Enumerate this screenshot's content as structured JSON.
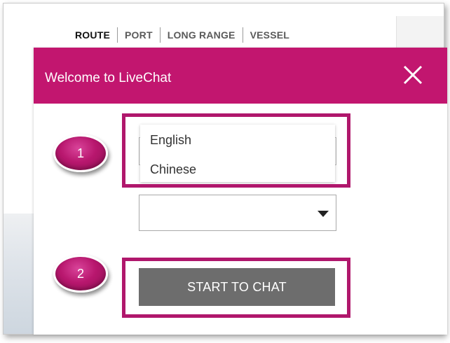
{
  "nav": {
    "items": [
      "ROUTE",
      "PORT",
      "LONG RANGE",
      "VESSEL"
    ],
    "active": "ROUTE"
  },
  "dialog": {
    "title": "Welcome to LiveChat",
    "close_icon": "close-icon",
    "language_options": [
      "English",
      "Chinese"
    ],
    "second_select_value": "",
    "start_button_label": "START TO CHAT"
  },
  "annotations": {
    "step1": "1",
    "step2": "2"
  },
  "colors": {
    "header": "#c2166f",
    "highlight": "#b0176c",
    "button": "#6d6d6d"
  }
}
